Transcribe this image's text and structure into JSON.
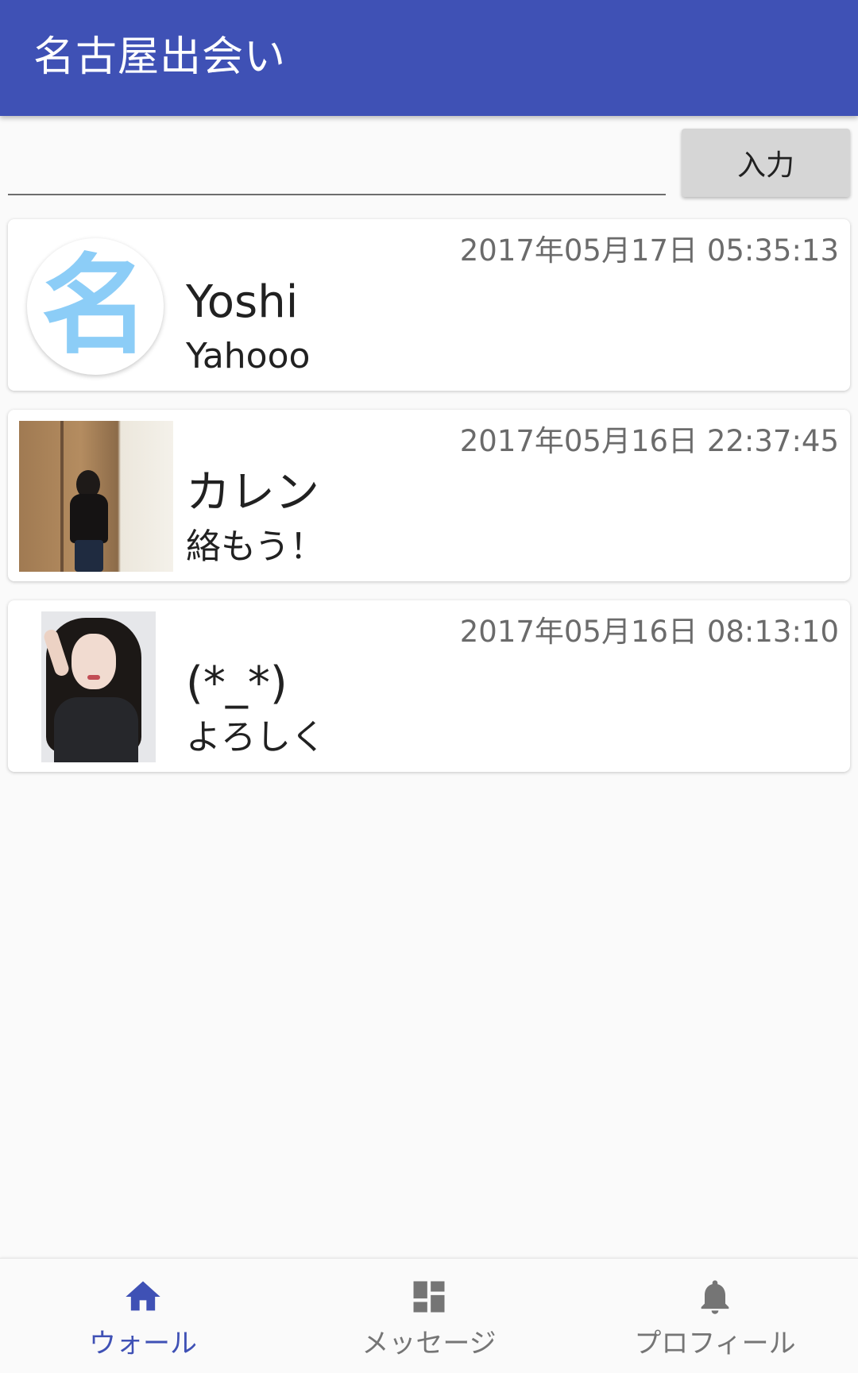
{
  "app_bar": {
    "title": "名古屋出会い"
  },
  "compose": {
    "input_value": "",
    "submit_label": "入力"
  },
  "posts": [
    {
      "timestamp": "2017年05月17日 05:35:13",
      "name": "Yoshi",
      "message": "Yahooo",
      "avatar_letter": "名",
      "avatar_type": "letter-badge"
    },
    {
      "timestamp": "2017年05月16日 22:37:45",
      "name": "カレン",
      "message": "絡もう！",
      "avatar_type": "photo"
    },
    {
      "timestamp": "2017年05月16日 08:13:10",
      "name": "(*_*)",
      "message": "よろしく",
      "avatar_type": "photo"
    }
  ],
  "bottom_nav": {
    "items": [
      {
        "label": "ウォール",
        "icon": "home-icon",
        "active": true
      },
      {
        "label": "メッセージ",
        "icon": "dashboard-icon",
        "active": false
      },
      {
        "label": "プロフィール",
        "icon": "bell-icon",
        "active": false
      }
    ]
  },
  "colors": {
    "primary": "#3f51b5",
    "badge_letter": "#8ccdf7",
    "inactive": "#757575",
    "timestamp": "#6b6b6b"
  }
}
